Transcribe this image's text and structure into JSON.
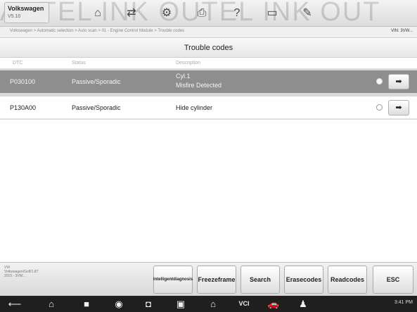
{
  "header": {
    "vehicle_brand": "Volkswagen",
    "vehicle_version": "V5.10",
    "watermark": "AUTEL INK OUTEL INK OUT"
  },
  "breadcrumb": {
    "path": "Volkswagen > Automatic selection > Auto scan > 01 - Engine Control Module > Trouble codes",
    "vin": "VIN: 3VW..."
  },
  "page": {
    "title": "Trouble codes"
  },
  "table": {
    "columns": [
      "DTC",
      "Status",
      "Description",
      ""
    ],
    "rows": [
      {
        "code": "P030100",
        "status": "Passive/Sporadic",
        "description_line1": "Cyl.1",
        "description_line2": "Misfire Detected",
        "selected": true
      },
      {
        "code": "P130A00",
        "status": "Passive/Sporadic",
        "description_line1": "Hide cylinder",
        "description_line2": "",
        "selected": false
      }
    ]
  },
  "footer": {
    "info_line1": "VW",
    "info_line2": "Volkswagen/Golf/1.8T",
    "info_line3": "2015 - 3VW...",
    "buttons": {
      "intelligent": "Intelligent diagnosis",
      "freeze": "Freeze frame",
      "search": "Search",
      "erase": "Erase codes",
      "read": "Read codes",
      "esc": "ESC"
    }
  },
  "system_bar": {
    "vci_label": "VCI",
    "clock": "3:41 PM"
  }
}
